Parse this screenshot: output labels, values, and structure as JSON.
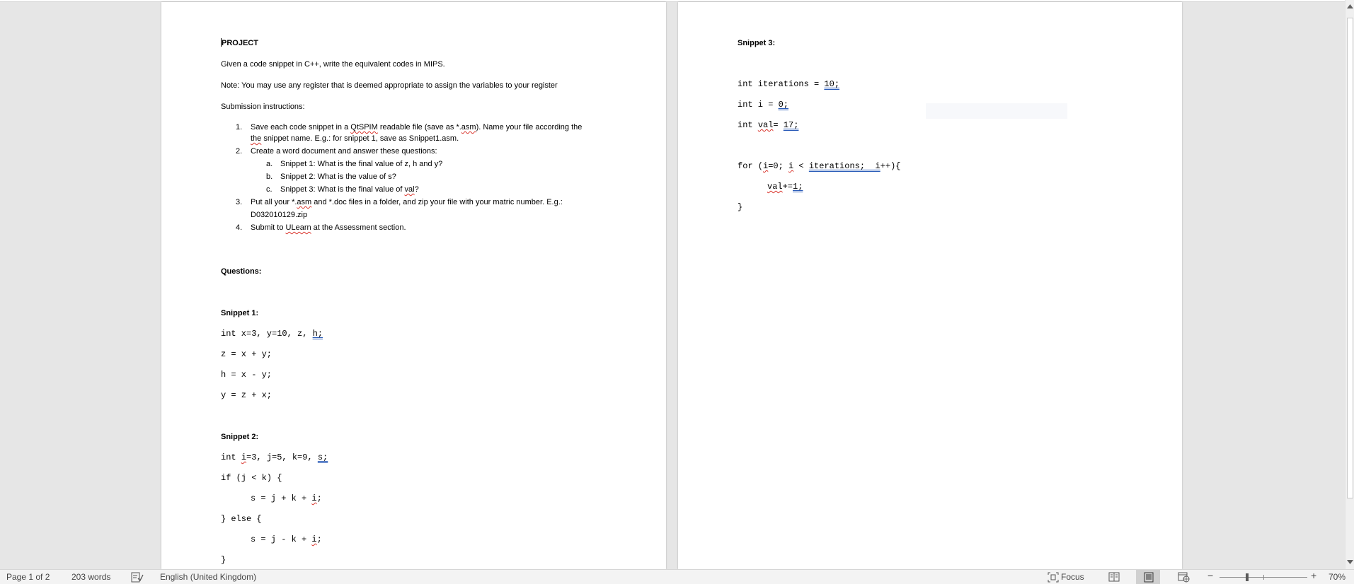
{
  "page1": {
    "title": "PROJECT",
    "intro": "Given a code snippet in C++, write the equivalent codes in MIPS.",
    "note": "Note:  You may use any register that is deemed appropriate to assign the variables to your register",
    "submission_heading": "Submission instructions:",
    "list": {
      "item1_num": "1.",
      "item1_a": "Save each code snippet in a ",
      "item1_b": "QtSPIM",
      "item1_c": " readable file (save as *.",
      "item1_d": "asm",
      "item1_e": ").  Name your file according the",
      "item1_f": "the",
      "item1_g": " snippet name.  E.g.: for snippet 1, save as Snippet1.asm.",
      "item2_num": "2.",
      "item2": "Create a word document and answer these questions:",
      "sub_a_num": "a.",
      "sub_a": "Snippet 1: What is the final value of z, h and y?",
      "sub_b_num": "b.",
      "sub_b": "Snippet 2:  What is the value of s?",
      "sub_c_num": "c.",
      "sub_c_a": "Snippet 3:  What is the final value of ",
      "sub_c_b": "val",
      "sub_c_c": "?",
      "item3_num": "3.",
      "item3_a": "Put all your *.",
      "item3_b": "asm",
      "item3_c": " and *.doc files in a folder, and zip your file with your matric number.  E.g.:",
      "item3_d": "D032010129.zip",
      "item4_num": "4.",
      "item4_a": "Submit to ",
      "item4_b": "ULearn",
      "item4_c": " at the Assessment section."
    },
    "questions_heading": "Questions:",
    "snippet1": {
      "heading": "Snippet 1:",
      "l1a": "int x=3, y=10, z, ",
      "l1b": "h;",
      "l2": "z = x + y;",
      "l3": "h = x - y;",
      "l4": "y = z + x;"
    },
    "snippet2": {
      "heading": "Snippet 2:",
      "l1a": "int ",
      "l1b": "i",
      "l1c": "=3, j=5, k=9, ",
      "l1d": "s;",
      "l2": "if (j < k) {",
      "l3a": "s = j + k + ",
      "l3b": "i",
      "l3c": ";",
      "l4": "} else {",
      "l5a": "s = j - k + ",
      "l5b": "i",
      "l5c": ";",
      "l6": "}"
    }
  },
  "page2": {
    "snippet3": {
      "heading": "Snippet 3:",
      "l1a": "int iterations = ",
      "l1b": "10;",
      "l2a": "int i = ",
      "l2b": "0;",
      "l3a": "int ",
      "l3b": "val",
      "l3c": "= ",
      "l3d": "17;",
      "l4a": "for (",
      "l4b": "i",
      "l4c": "=0; ",
      "l4d": "i",
      "l4e": " < ",
      "l4f": "iterations;  i",
      "l4g": "++){",
      "l5a": "val",
      "l5b": "+=",
      "l5c": "1;",
      "l6": "}"
    }
  },
  "statusbar": {
    "page": "Page 1 of 2",
    "words": "203 words",
    "language": "English (United Kingdom)",
    "focus": "Focus",
    "zoom_minus": "−",
    "zoom_plus": "+",
    "zoom_level": "70%",
    "zoom_fraction": 0.7
  },
  "icons": {
    "proofing": "proofing-check-icon",
    "focus": "focus-icon",
    "read_mode": "read-mode-icon",
    "print_layout": "print-layout-icon",
    "web_layout": "web-layout-icon"
  }
}
